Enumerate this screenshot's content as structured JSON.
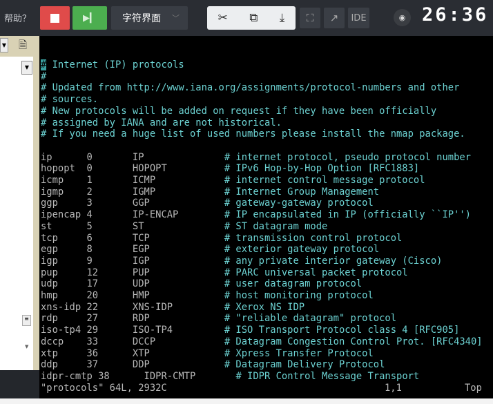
{
  "toolbar": {
    "help": "帮助？",
    "mode": "字符界面",
    "ide": "IDE",
    "clock": "26:36",
    "icons": [
      "stop-icon",
      "step-icon",
      "cut-icon",
      "screen-share-icon",
      "download-icon",
      "fullscreen-icon",
      "external-link-icon",
      "eye-icon"
    ]
  },
  "colors": {
    "stop": "#e04b4a",
    "run": "#4cae4f",
    "comment": "#6cd2d2",
    "background": "#000000"
  },
  "editor": {
    "header": [
      "# Internet (IP) protocols",
      "#",
      "# Updated from http://www.iana.org/assignments/protocol-numbers and other",
      "# sources.",
      "# New protocols will be added on request if they have been officially",
      "# assigned by IANA and are not historical.",
      "# If you need a huge list of used numbers please install the nmap package."
    ],
    "rows": [
      [
        "ip",
        "0",
        "IP",
        "# internet protocol, pseudo protocol number"
      ],
      [
        "hopopt",
        "0",
        "HOPOPT",
        "# IPv6 Hop-by-Hop Option [RFC1883]"
      ],
      [
        "icmp",
        "1",
        "ICMP",
        "# internet control message protocol"
      ],
      [
        "igmp",
        "2",
        "IGMP",
        "# Internet Group Management"
      ],
      [
        "ggp",
        "3",
        "GGP",
        "# gateway-gateway protocol"
      ],
      [
        "ipencap",
        "4",
        "IP-ENCAP",
        "# IP encapsulated in IP (officially ``IP'')"
      ],
      [
        "st",
        "5",
        "ST",
        "# ST datagram mode"
      ],
      [
        "tcp",
        "6",
        "TCP",
        "# transmission control protocol"
      ],
      [
        "egp",
        "8",
        "EGP",
        "# exterior gateway protocol"
      ],
      [
        "igp",
        "9",
        "IGP",
        "# any private interior gateway (Cisco)"
      ],
      [
        "pup",
        "12",
        "PUP",
        "# PARC universal packet protocol"
      ],
      [
        "udp",
        "17",
        "UDP",
        "# user datagram protocol"
      ],
      [
        "hmp",
        "20",
        "HMP",
        "# host monitoring protocol"
      ],
      [
        "xns-idp",
        "22",
        "XNS-IDP",
        "# Xerox NS IDP"
      ],
      [
        "rdp",
        "27",
        "RDP",
        "# \"reliable datagram\" protocol"
      ],
      [
        "iso-tp4",
        "29",
        "ISO-TP4",
        "# ISO Transport Protocol class 4 [RFC905]"
      ],
      [
        "dccp",
        "33",
        "DCCP",
        "# Datagram Congestion Control Prot. [RFC4340]"
      ],
      [
        "xtp",
        "36",
        "XTP",
        "# Xpress Transfer Protocol"
      ],
      [
        "ddp",
        "37",
        "DDP",
        "# Datagram Delivery Protocol"
      ],
      [
        "idpr-cmtp",
        "38",
        "IDPR-CMTP",
        "# IDPR Control Message Transport"
      ]
    ],
    "status": {
      "file": "\"protocols\" 64L, 2932C",
      "position": "1,1",
      "scroll": "Top"
    }
  }
}
